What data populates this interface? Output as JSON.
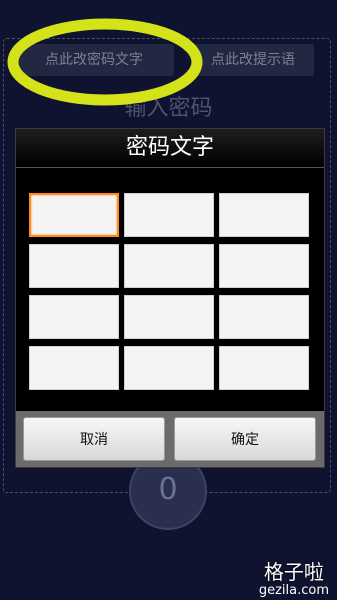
{
  "background": {
    "change_password_text_button": "点此改密码文字",
    "change_hint_button": "点此改提示语",
    "title": "输入密码",
    "circle_digit": "0"
  },
  "dialog": {
    "title": "密码文字",
    "cells": [
      "",
      "",
      "",
      "",
      "",
      "",
      "",
      "",
      "",
      "",
      "",
      ""
    ],
    "cancel_label": "取消",
    "ok_label": "确定"
  },
  "watermark": {
    "cn": "格子啦",
    "en": "gezila.com"
  },
  "colors": {
    "background": "#0f1330",
    "highlight": "#d4e21a",
    "focus_border": "#ff8c1a"
  }
}
